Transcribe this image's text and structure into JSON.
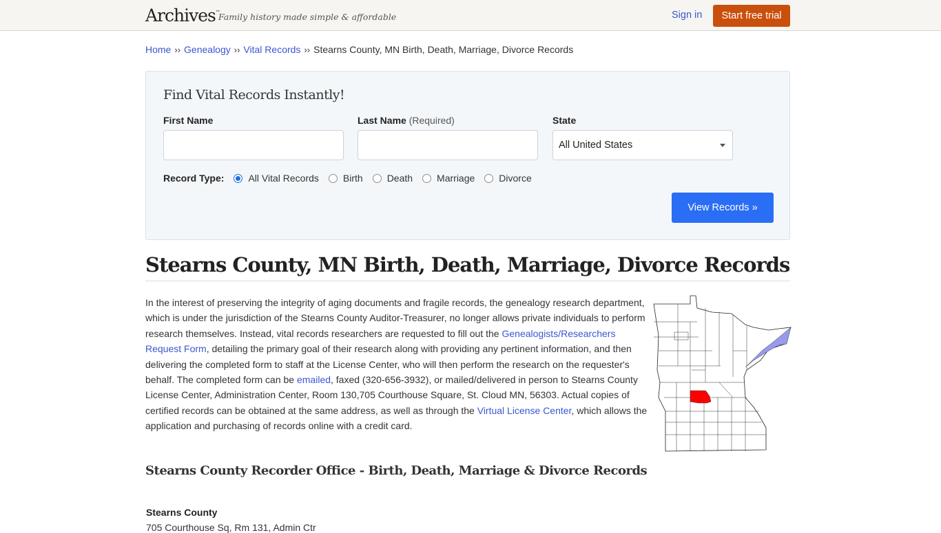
{
  "header": {
    "logo": "Archives",
    "logo_tm": "™",
    "tagline": "Family history made simple & affordable",
    "sign_in": "Sign in",
    "start_trial": "Start free trial"
  },
  "breadcrumb": {
    "items": [
      "Home",
      "Genealogy",
      "Vital Records"
    ],
    "separator": "››",
    "current": "Stearns County, MN Birth, Death, Marriage, Divorce Records"
  },
  "search": {
    "title": "Find Vital Records Instantly!",
    "first_name_label": "First Name",
    "first_name_value": "",
    "last_name_label": "Last Name",
    "last_name_required": "(Required)",
    "last_name_value": "",
    "state_label": "State",
    "state_selected": "All United States",
    "record_type_label": "Record Type:",
    "record_types": [
      "All Vital Records",
      "Birth",
      "Death",
      "Marriage",
      "Divorce"
    ],
    "record_type_selected": "All Vital Records",
    "submit": "View Records »"
  },
  "page": {
    "title": "Stearns County, MN Birth, Death, Marriage, Divorce Records",
    "intro": {
      "t1": "In the interest of preserving the integrity of aging documents and fragile records, the genealogy research department, which is under the jurisdiction of the Stearns County Auditor-Treasurer, no longer allows private individuals to perform research themselves. Instead, vital records researchers are requested to fill out the ",
      "link1": "Genealogists/Researchers Request Form",
      "t2": ", detailing the primary goal of their research along with providing any pertinent information, and then delivering the completed form to staff at the License Center, who will then perform the research on the requester's behalf. The completed form can be ",
      "link2": "emailed",
      "t3": ", faxed (320-656-3932), or mailed/delivered in person to Stearns County License Center, Administration Center, Room 130,705 Courthouse Square, St. Cloud MN, 56303. Actual copies of certified records can be obtained at the same address, as well as through the ",
      "link3": "Virtual License Center",
      "t4": ", which allows the application and purchasing of records online with a credit card."
    },
    "map": {
      "state": "Minnesota",
      "highlighted_county": "Stearns County",
      "highlight_color": "#ff0000",
      "lake_color": "#9999ee"
    },
    "section_title": "Stearns County Recorder Office - Birth, Death, Marriage & Divorce Records",
    "office": {
      "name": "Stearns County",
      "address": "705 Courthouse Sq, Rm 131, Admin Ctr"
    }
  },
  "colors": {
    "link": "#3a57d0",
    "trial_button": "#c94f0c",
    "view_button": "#2a6ef5"
  }
}
